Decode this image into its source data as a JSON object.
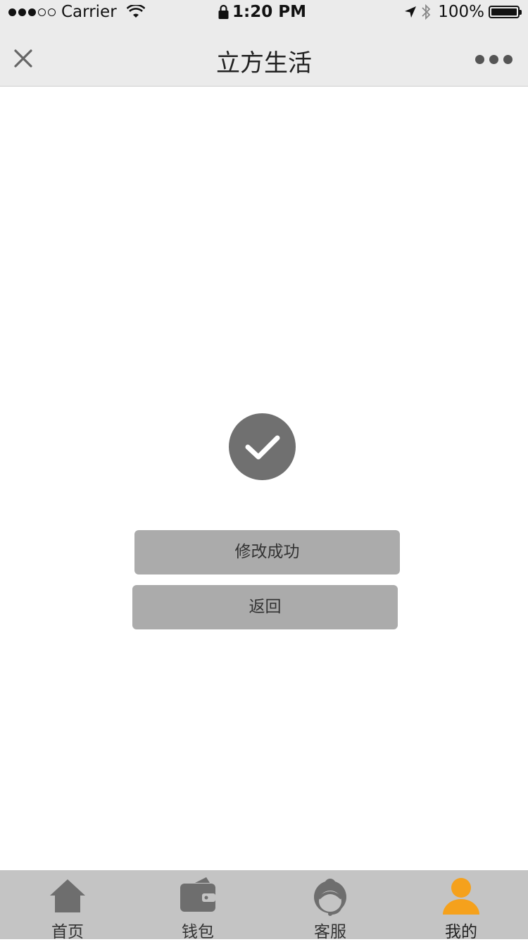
{
  "status_bar": {
    "carrier": "Carrier",
    "time": "1:20 PM",
    "battery": "100%",
    "signal_filled": 3,
    "signal_empty": 2
  },
  "nav": {
    "title": "立方生活",
    "close_icon": "close-icon",
    "more_icon": "more-icon"
  },
  "content": {
    "status_text": "修改成功",
    "back_label": "返回",
    "icon": "check-circle-icon",
    "icon_color": "#707070",
    "button_color": "#ababab"
  },
  "tabbar": {
    "active_color": "#f5a11c",
    "inactive_color": "#6e6e6e",
    "items": [
      {
        "label": "首页",
        "icon": "home-icon"
      },
      {
        "label": "钱包",
        "icon": "wallet-icon"
      },
      {
        "label": "客服",
        "icon": "customer-service-icon"
      },
      {
        "label": "我的",
        "icon": "user-icon",
        "active": true
      }
    ]
  }
}
